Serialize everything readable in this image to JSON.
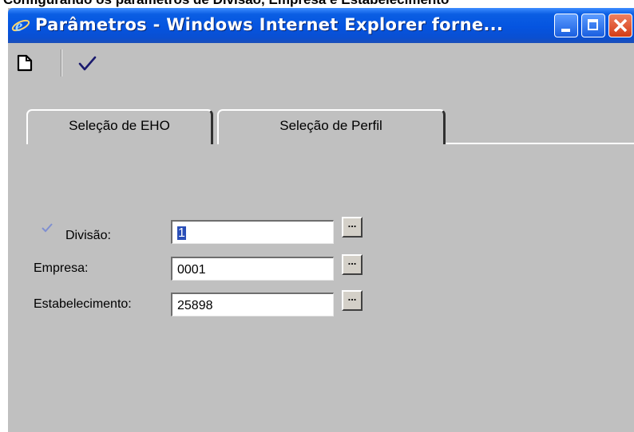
{
  "page_caption": "Configurando os parâmetros de Divisão, Empresa e Estabelecimento",
  "window": {
    "title": "Parâmetros - Windows Internet Explorer forne...",
    "icon": "ie-icon"
  },
  "toolbar": {
    "new_icon": "new-document-icon",
    "confirm_icon": "checkmark-icon"
  },
  "tabs": [
    {
      "label": "Seleção de EHO",
      "active": true
    },
    {
      "label": "Seleção de Perfil",
      "active": false
    }
  ],
  "form": {
    "divisao": {
      "label": "Divisão:",
      "value": "1",
      "lookup_label": "..."
    },
    "empresa": {
      "label": "Empresa:",
      "value": "0001",
      "lookup_label": "..."
    },
    "estabelecimento": {
      "label": "Estabelecimento:",
      "value": "25898",
      "lookup_label": "..."
    }
  },
  "colors": {
    "titlebar": "#0554e0",
    "window_bg": "#c0c0c0",
    "close_button": "#d33c16",
    "selection": "#2a4fb8"
  }
}
